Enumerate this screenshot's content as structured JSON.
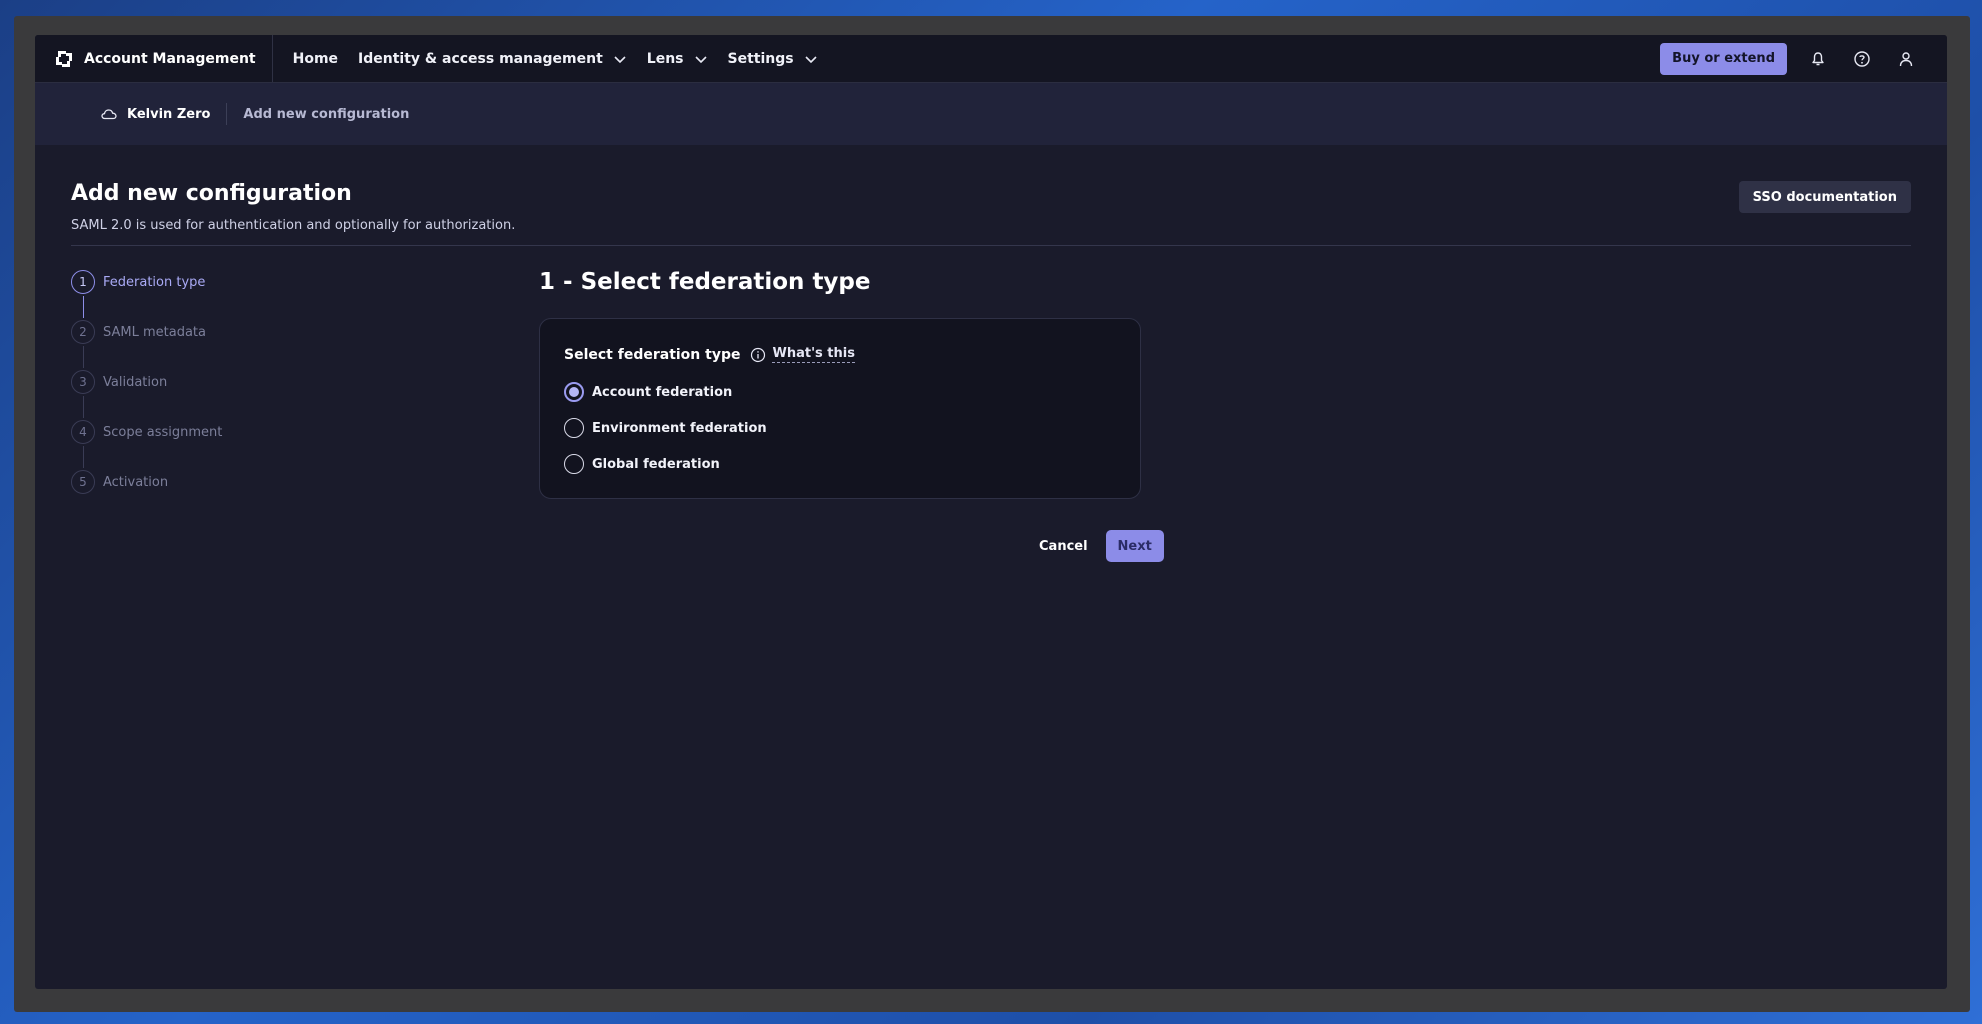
{
  "app": {
    "name": "Account Management"
  },
  "nav": {
    "items": [
      {
        "label": "Home",
        "has_dropdown": false
      },
      {
        "label": "Identity & access management",
        "has_dropdown": true
      },
      {
        "label": "Lens",
        "has_dropdown": true
      },
      {
        "label": "Settings",
        "has_dropdown": true
      }
    ],
    "buy_label": "Buy or extend",
    "icons": [
      "bell-icon",
      "help-icon",
      "user-icon"
    ]
  },
  "breadcrumb": {
    "environment": "Kelvin Zero",
    "current": "Add new configuration"
  },
  "page": {
    "title": "Add new configuration",
    "subtitle": "SAML 2.0 is used for authentication and optionally for authorization.",
    "sso_doc_label": "SSO documentation"
  },
  "stepper": {
    "steps": [
      {
        "num": "1",
        "label": "Federation type",
        "active": true
      },
      {
        "num": "2",
        "label": "SAML metadata",
        "active": false
      },
      {
        "num": "3",
        "label": "Validation",
        "active": false
      },
      {
        "num": "4",
        "label": "Scope assignment",
        "active": false
      },
      {
        "num": "5",
        "label": "Activation",
        "active": false
      }
    ]
  },
  "main": {
    "section_title": "1 - Select federation type",
    "card_title": "Select federation type",
    "whats_this": "What's this",
    "options": [
      {
        "label": "Account federation",
        "checked": true
      },
      {
        "label": "Environment federation",
        "checked": false
      },
      {
        "label": "Global federation",
        "checked": false
      }
    ],
    "cancel_label": "Cancel",
    "next_label": "Next"
  },
  "colors": {
    "accent": "#8c8ce8",
    "background": "#1a1b2b",
    "nav_background": "#141522"
  }
}
